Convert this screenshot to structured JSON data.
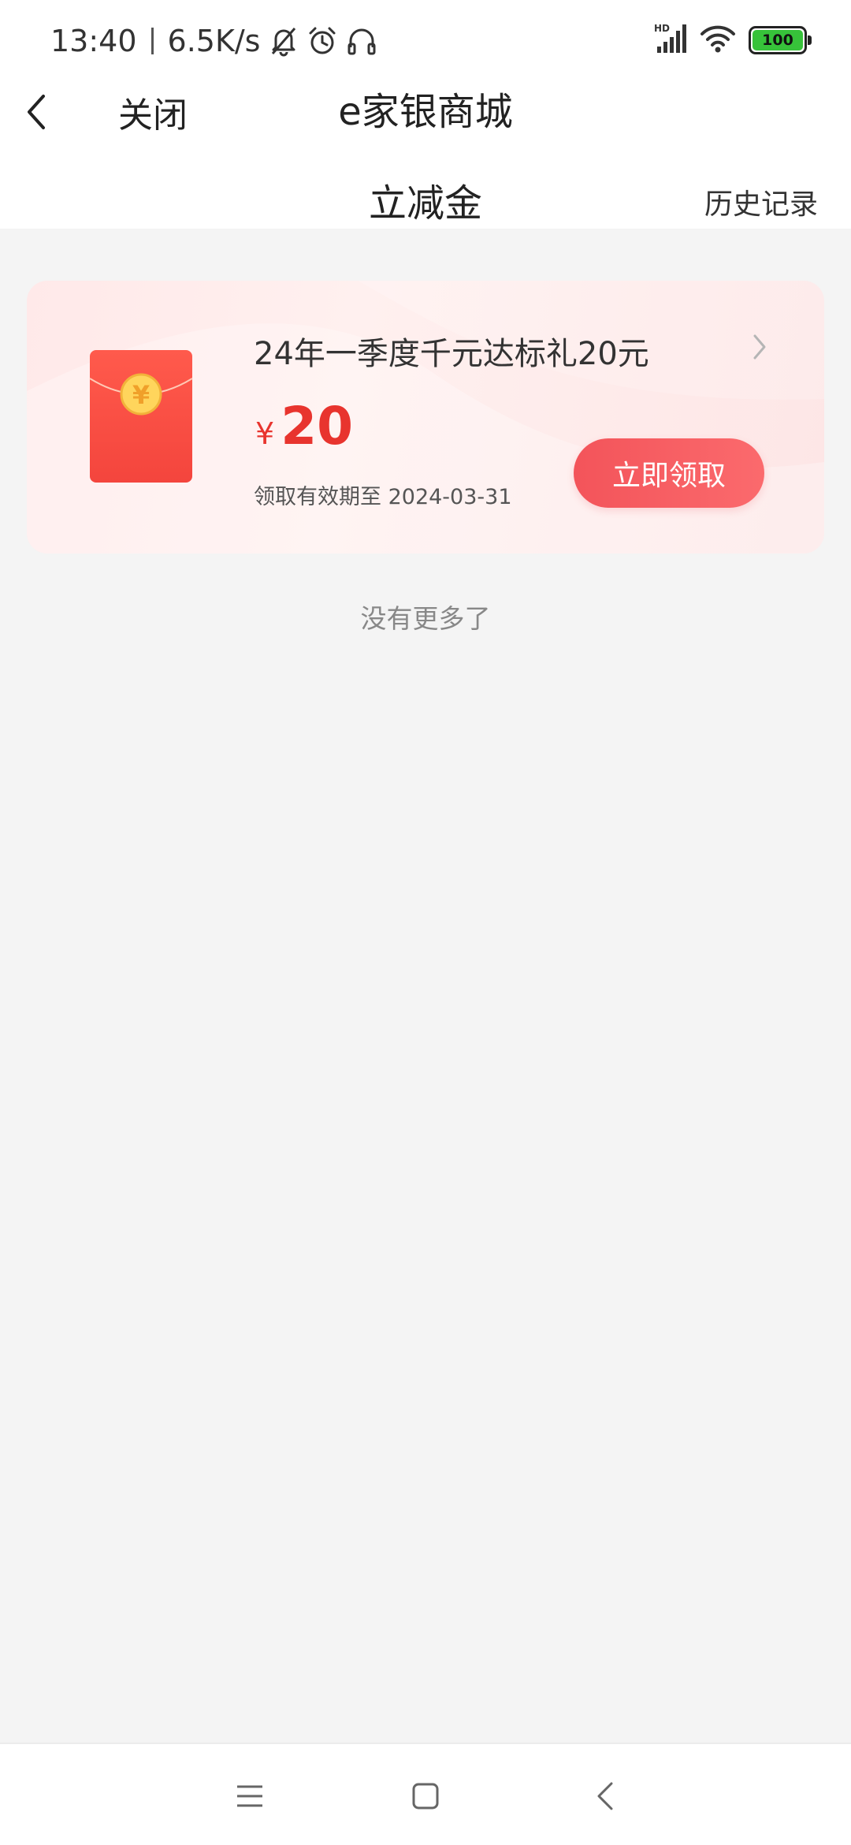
{
  "status_bar": {
    "time": "13:40",
    "net_speed": "6.5K/s",
    "battery_level": "100",
    "icons": [
      "mute-bell-icon",
      "alarm-icon",
      "headset-icon",
      "hd-signal-icon",
      "wifi-icon",
      "battery-icon"
    ]
  },
  "nav": {
    "close_label": "关闭",
    "app_title": "e家银商城",
    "page_title": "立减金",
    "history_label": "历史记录"
  },
  "coupon": {
    "title": "24年一季度千元达标礼20元",
    "currency": "¥",
    "amount": "20",
    "validity": "领取有效期至 2024-03-31",
    "claim_label": "立即领取",
    "coin_symbol": "¥"
  },
  "list": {
    "end_text": "没有更多了"
  },
  "colors": {
    "accent_red": "#e8342e",
    "button_red": "#f3545a",
    "card_bg": "#ffe9e9",
    "battery_green": "#37c23a"
  }
}
